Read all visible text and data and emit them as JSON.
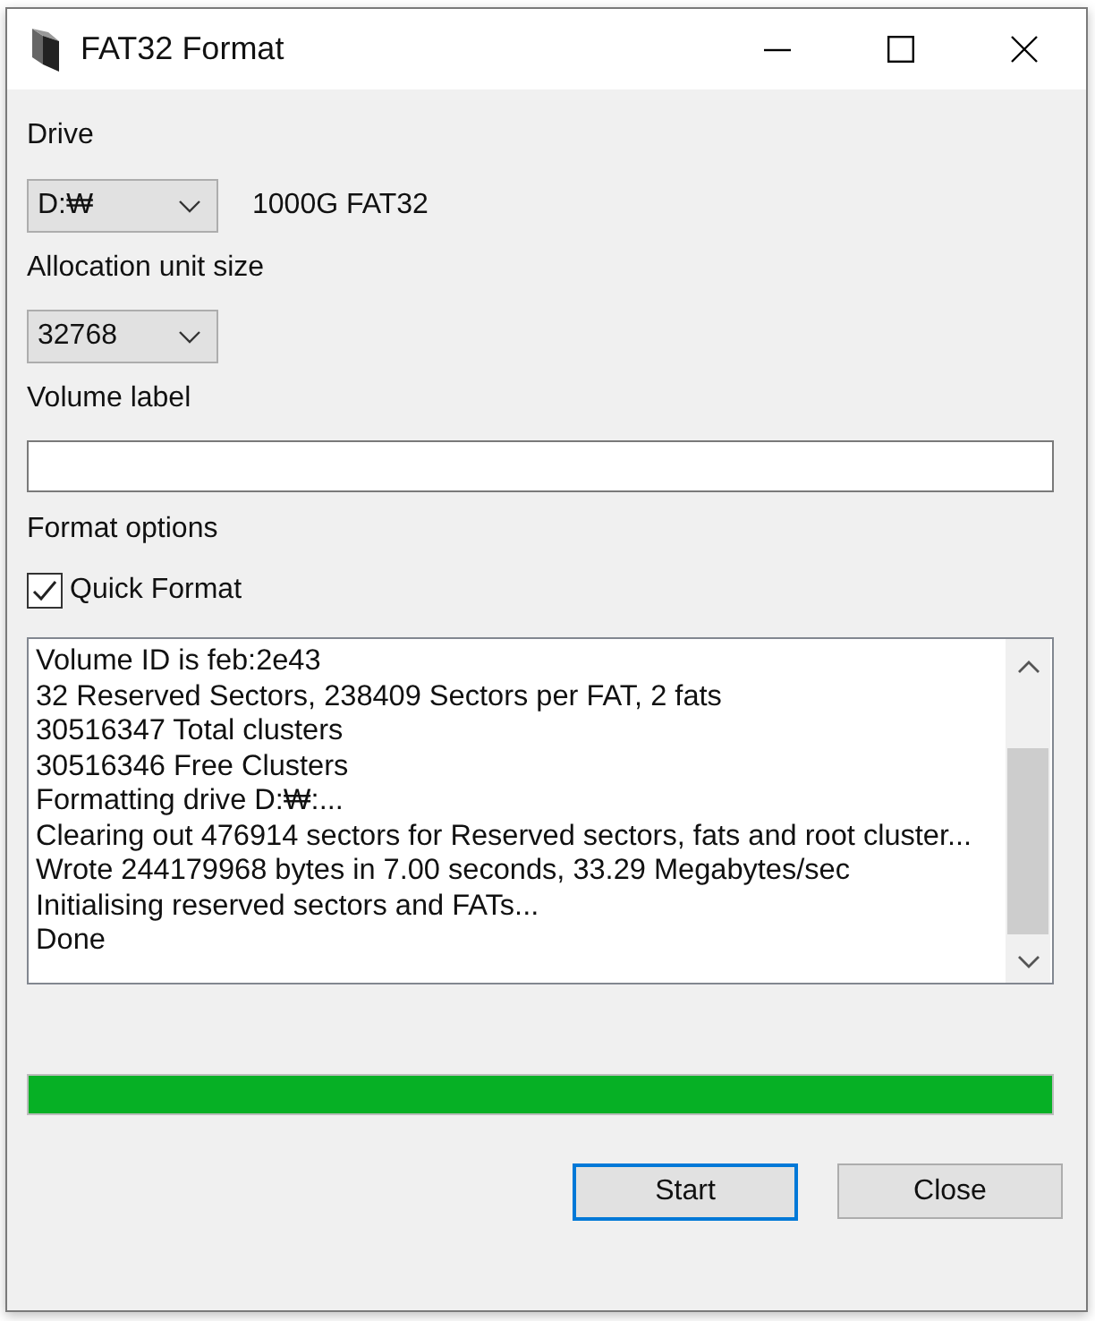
{
  "window": {
    "title": "FAT32 Format"
  },
  "drive": {
    "label": "Drive",
    "value": "D:₩",
    "info": "1000G FAT32"
  },
  "allocation": {
    "label": "Allocation unit size",
    "value": "32768"
  },
  "volume_label": {
    "label": "Volume label"
  },
  "format_options": {
    "label": "Format options",
    "quick_format": {
      "label": "Quick Format",
      "checked": true
    }
  },
  "log": {
    "lines": [
      "Volume ID is feb:2e43",
      "32 Reserved Sectors, 238409 Sectors per FAT, 2 fats",
      "30516347 Total clusters",
      "30516346 Free Clusters",
      "Formatting drive D:₩:...",
      "Clearing out 476914 sectors for Reserved sectors, fats and root cluster...",
      "Wrote 244179968 bytes in 7.00 seconds, 33.29 Megabytes/sec",
      "Initialising reserved sectors and FATs...",
      "Done"
    ]
  },
  "progress": {
    "level": 1
  },
  "buttons": [
    {
      "label": "Start",
      "focused": true
    },
    {
      "label": "Close",
      "focused": false
    }
  ]
}
